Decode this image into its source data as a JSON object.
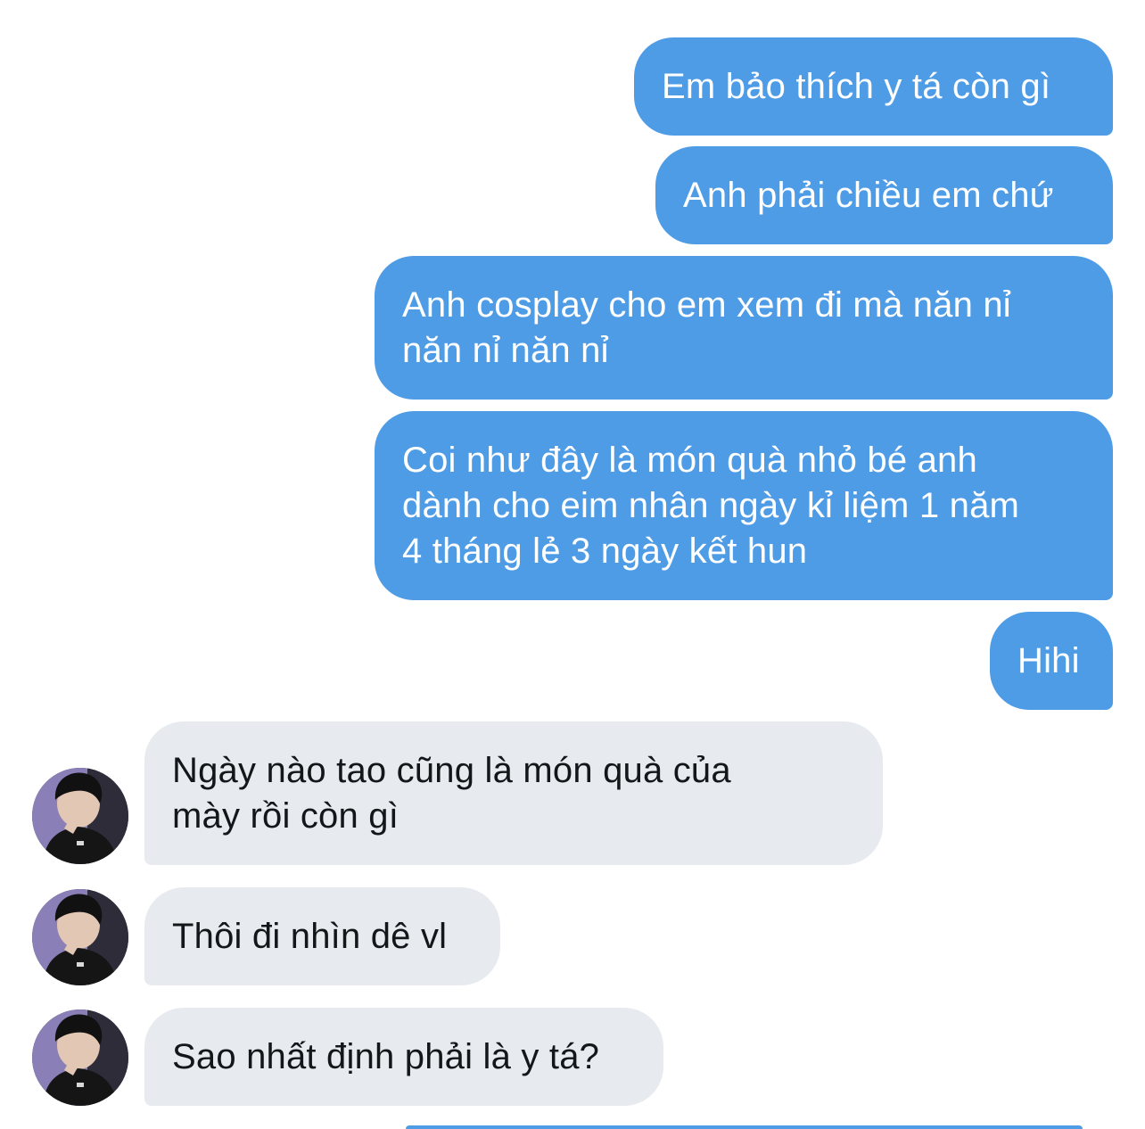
{
  "conversation": {
    "outgoing": [
      {
        "text": "Em bảo thích y tá còn gì"
      },
      {
        "text": "Anh phải chiều em chứ"
      },
      {
        "text": "Anh cosplay cho em xem đi mà năn nỉ\nnăn nỉ năn nỉ"
      },
      {
        "text": "Coi như đây là món quà nhỏ bé anh\ndành cho eim nhân ngày kỉ liệm 1 năm\n4 tháng lẻ 3 ngày kết hun"
      },
      {
        "text": "Hihi"
      }
    ],
    "incoming": [
      {
        "text": "Ngày nào tao cũng là món quà của\nmày rồi còn gì"
      },
      {
        "text": "Thôi đi nhìn dê vl"
      },
      {
        "text": "Sao nhất định phải là y tá?"
      }
    ]
  },
  "colors": {
    "outgoing_bubble": "#4f9ce6",
    "incoming_bubble": "#e7ebef",
    "incoming_text": "#14171a",
    "background": "#ffffff"
  },
  "icons": {
    "avatar": "profile-photo"
  }
}
